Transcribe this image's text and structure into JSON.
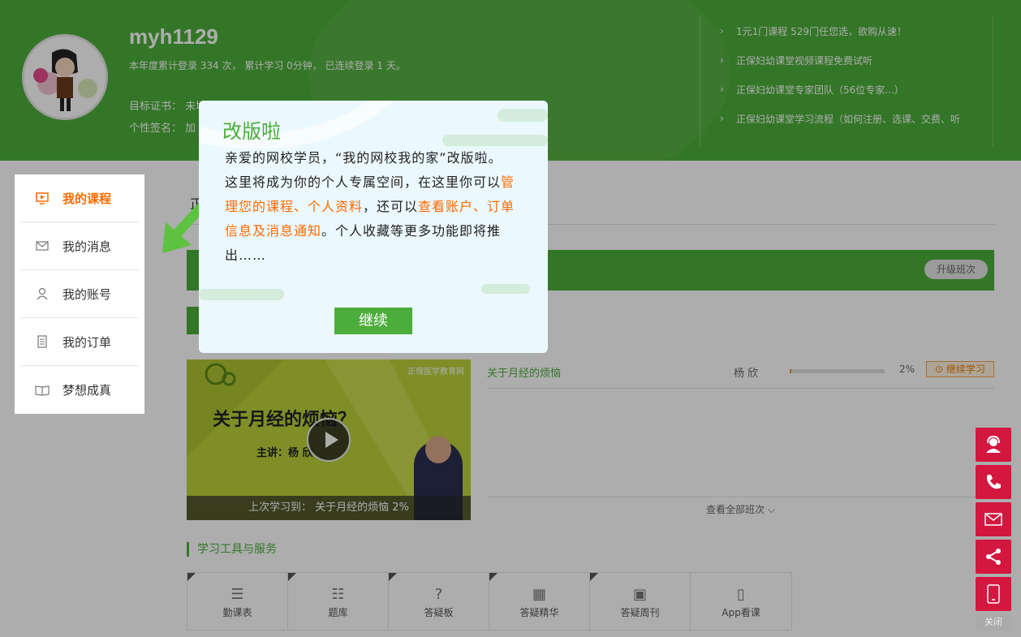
{
  "header": {
    "username": "myh1129",
    "stats": "本年度累计登录 334 次， 累计学习 0分钟， 已连续登录 1 天。",
    "cert": "目标证书： 未填写",
    "sign": "个性签名： 加",
    "news": [
      "1元1门课程 529门任您选，欲购从速！",
      "正保妇幼课堂视频课程免费试听",
      "正保妇幼课堂专家团队（56位专家...）",
      "正保妇幼课堂学习流程（如何注册、选课、交费、听"
    ]
  },
  "sidebar": {
    "items": [
      {
        "label": "我的课程",
        "icon": "monitor-play-icon"
      },
      {
        "label": "我的消息",
        "icon": "envelope-icon"
      },
      {
        "label": "我的账号",
        "icon": "user-icon"
      },
      {
        "label": "我的订单",
        "icon": "document-icon"
      },
      {
        "label": "梦想成真",
        "icon": "book-icon"
      }
    ]
  },
  "main": {
    "tab_stub": "正",
    "upgrade_label": "升级班次",
    "video": {
      "title": "关于月经的烦恼？",
      "speaker": "主讲：杨 欣",
      "logo": "正保医学教育网",
      "last_study": "上次学习到： 关于月经的烦恼 2%"
    },
    "course": {
      "name": "关于月经的烦恼",
      "teacher": "杨  欣",
      "progress_pct": "2%",
      "progress_value": 0.02,
      "continue_label": "继续学习"
    },
    "view_all": "查看全部班次 ⌵",
    "tools_title": "学习工具与服务",
    "tools": [
      {
        "label": "勤课表",
        "icon": "list-icon",
        "glyph": "☰"
      },
      {
        "label": "题库",
        "icon": "checklist-icon",
        "glyph": "☷"
      },
      {
        "label": "答疑板",
        "icon": "question-icon",
        "glyph": "?"
      },
      {
        "label": "答疑精华",
        "icon": "badge-icon",
        "glyph": "▦"
      },
      {
        "label": "答疑周刊",
        "icon": "calendar-icon",
        "glyph": "▣"
      },
      {
        "label": "App看课",
        "icon": "phone-icon",
        "glyph": "▯"
      }
    ]
  },
  "popup": {
    "title": "改版啦",
    "line1": "亲爱的网校学员，“我的网校我的家”改版啦。",
    "line2_a": "这里将成为你的个人专属空间，在这里你可以",
    "line2_hl1": "管理您的课程、个人资料",
    "line2_b": "，还可以",
    "line2_hl2": "查看账户、订单信息及消息通知",
    "line2_c": "。个人收藏等更多功能即将推出……",
    "button": "继续"
  },
  "float_bar": {
    "items": [
      "headset-icon",
      "phone-icon",
      "mail-icon",
      "share-icon",
      "mobile-icon"
    ],
    "close": "关闭"
  },
  "colors": {
    "brand_green": "#4cae3a",
    "highlight_orange": "#ff6a00",
    "float_red": "#d3173f"
  }
}
